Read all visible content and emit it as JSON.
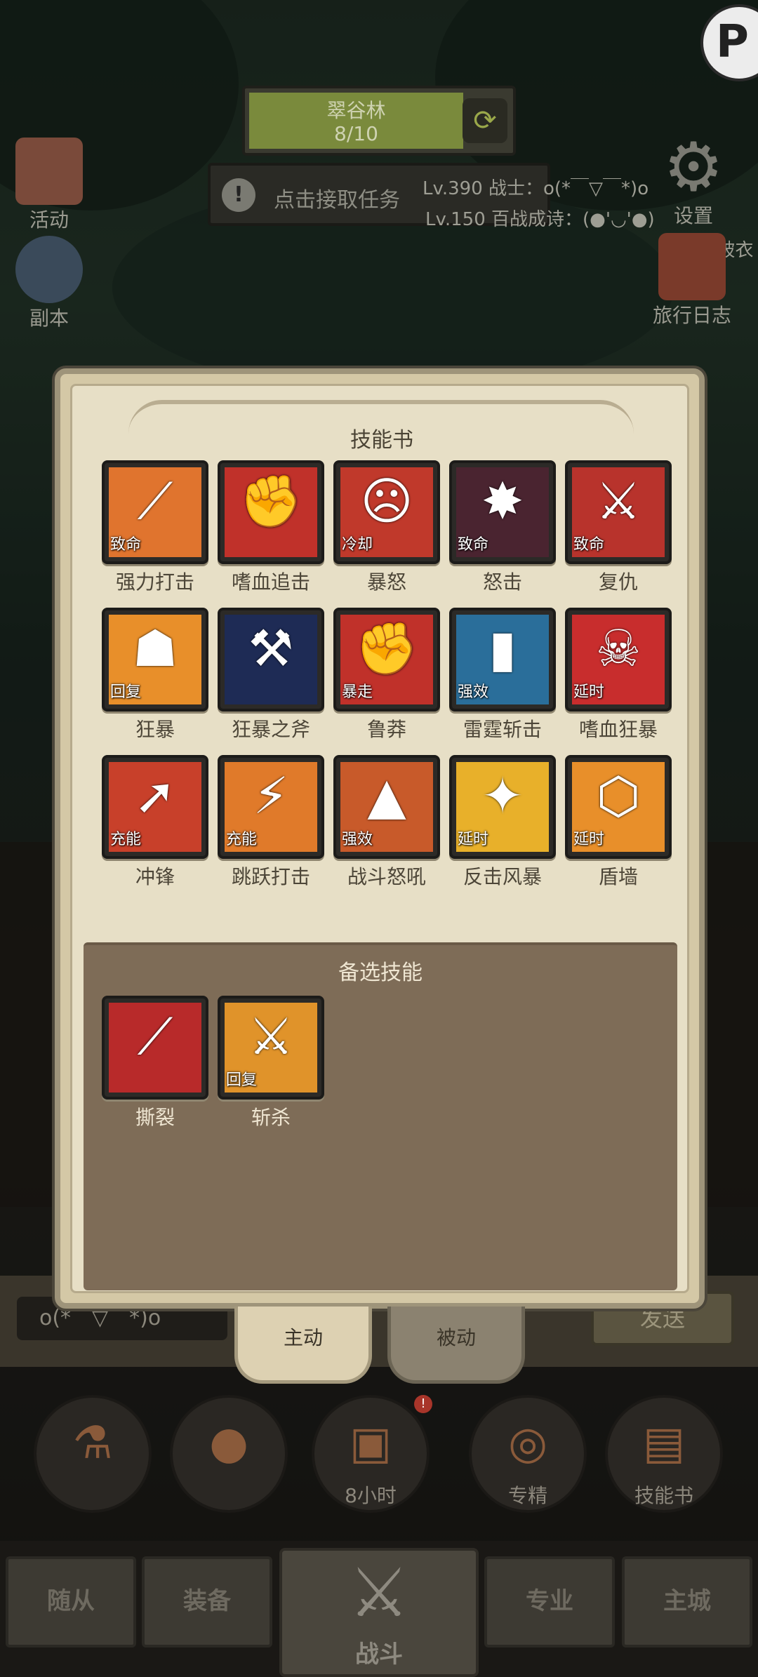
{
  "hud": {
    "zone_name": "翠谷林",
    "zone_progress": "8/10",
    "refresh_icon": "refresh-icon",
    "quest_text": "点击接取任务",
    "quest_icon": "info-icon",
    "chat_line1": "Lv.390 战士：o(*￣▽￣*)o",
    "chat_line2": "Lv.150 百战成诗：(●'◡'●)",
    "chat_line3": "Lv.39 破衣",
    "left_buttons": [
      {
        "label": "活动",
        "icon": "activity-book-icon"
      },
      {
        "label": "副本",
        "icon": "dungeon-portal-icon"
      }
    ],
    "right_buttons": [
      {
        "label": "设置",
        "icon": "gear-icon"
      },
      {
        "label": "旅行日志",
        "icon": "journal-icon"
      }
    ],
    "corner_badge": "P"
  },
  "dialog": {
    "title": "技能书",
    "active_skills": [
      {
        "name": "强力打击",
        "tag": "致命",
        "icon": "blade-strike-icon",
        "bg": "#e0742e"
      },
      {
        "name": "嗜血追击",
        "tag": "",
        "icon": "fist-icon",
        "bg": "#c0312a"
      },
      {
        "name": "暴怒",
        "tag": "冷却",
        "icon": "roaring-face-icon",
        "bg": "#c0392b"
      },
      {
        "name": "怒击",
        "tag": "致命",
        "icon": "spiked-axe-icon",
        "bg": "#4a2430"
      },
      {
        "name": "复仇",
        "tag": "致命",
        "icon": "sword-icon",
        "bg": "#b8332c"
      },
      {
        "name": "狂暴",
        "tag": "回复",
        "icon": "hooded-figure-icon",
        "bg": "#e88f2a"
      },
      {
        "name": "狂暴之斧",
        "tag": "",
        "icon": "lightning-axe-icon",
        "bg": "#1e2b55"
      },
      {
        "name": "鲁莽",
        "tag": "暴走",
        "icon": "raised-fist-icon",
        "bg": "#c0312a"
      },
      {
        "name": "雷霆斩击",
        "tag": "强效",
        "icon": "thunder-slash-icon",
        "bg": "#2a6e9a"
      },
      {
        "name": "嗜血狂暴",
        "tag": "延时",
        "icon": "demon-mask-icon",
        "bg": "#c82d2d"
      },
      {
        "name": "冲锋",
        "tag": "充能",
        "icon": "charge-arrow-icon",
        "bg": "#c8402a"
      },
      {
        "name": "跳跃打击",
        "tag": "充能",
        "icon": "leap-strike-icon",
        "bg": "#e07a2a"
      },
      {
        "name": "战斗怒吼",
        "tag": "强效",
        "icon": "battle-shout-icon",
        "bg": "#c85a2a"
      },
      {
        "name": "反击风暴",
        "tag": "延时",
        "icon": "counter-storm-icon",
        "bg": "#e8b02a"
      },
      {
        "name": "盾墙",
        "tag": "延时",
        "icon": "shield-wall-icon",
        "bg": "#e88f2a"
      }
    ],
    "alt_title": "备选技能",
    "alt_skills": [
      {
        "name": "撕裂",
        "tag": "",
        "icon": "rend-icon",
        "bg": "#b82a2a"
      },
      {
        "name": "斩杀",
        "tag": "回复",
        "icon": "execute-icon",
        "bg": "#e0932a"
      }
    ]
  },
  "tabs": {
    "active": "主动",
    "passive": "被动"
  },
  "chat": {
    "input_value": "o(*￣▽￣*)o",
    "send_label": "发送"
  },
  "actions": [
    {
      "label": "",
      "icon": "potion-icon"
    },
    {
      "label": "",
      "icon": "bread-icon"
    },
    {
      "label": "8小时",
      "icon": "treasure-chest-icon"
    },
    {
      "label": "专精",
      "icon": "specialization-icon"
    },
    {
      "label": "技能书",
      "icon": "skill-book-icon"
    }
  ],
  "nav": {
    "followers": "随从",
    "equipment": "装备",
    "battle": "战斗",
    "profession": "专业",
    "city": "主城"
  }
}
